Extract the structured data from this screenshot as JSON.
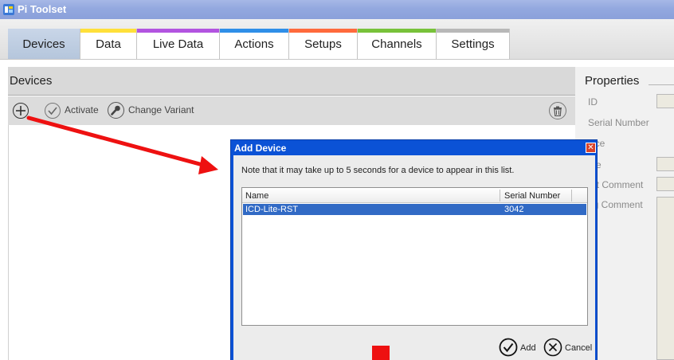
{
  "app": {
    "title": "Pi Toolset"
  },
  "tabs": [
    {
      "label": "Devices",
      "stripe": "",
      "active": true
    },
    {
      "label": "Data",
      "stripe": "#ffe03a"
    },
    {
      "label": "Live Data",
      "stripe": "#b254e0"
    },
    {
      "label": "Actions",
      "stripe": "#2f8fe8"
    },
    {
      "label": "Setups",
      "stripe": "#ff6a3c"
    },
    {
      "label": "Channels",
      "stripe": "#78c23a"
    },
    {
      "label": "Settings",
      "stripe": "#b8b8b8"
    }
  ],
  "devices": {
    "header": "Devices",
    "toolbar": {
      "activate": "Activate",
      "change_variant": "Change Variant"
    }
  },
  "properties": {
    "title": "Properties",
    "labels": [
      "ID",
      "Serial Number",
      "vice",
      "me",
      "ort Comment",
      "ng Comment"
    ]
  },
  "dialog": {
    "title": "Add Device",
    "note": "Note that it may take up to 5 seconds for a device to appear in this list.",
    "columns": {
      "name": "Name",
      "serial": "Serial Number"
    },
    "rows": [
      {
        "name": "ICD-Lite-RST",
        "serial": "3042"
      }
    ],
    "add_label": "Add",
    "cancel_label": "Cancel"
  },
  "colors": {
    "selection": "#316ac5",
    "dialog_frame": "#0b52d6",
    "annotation": "#ee1111"
  }
}
